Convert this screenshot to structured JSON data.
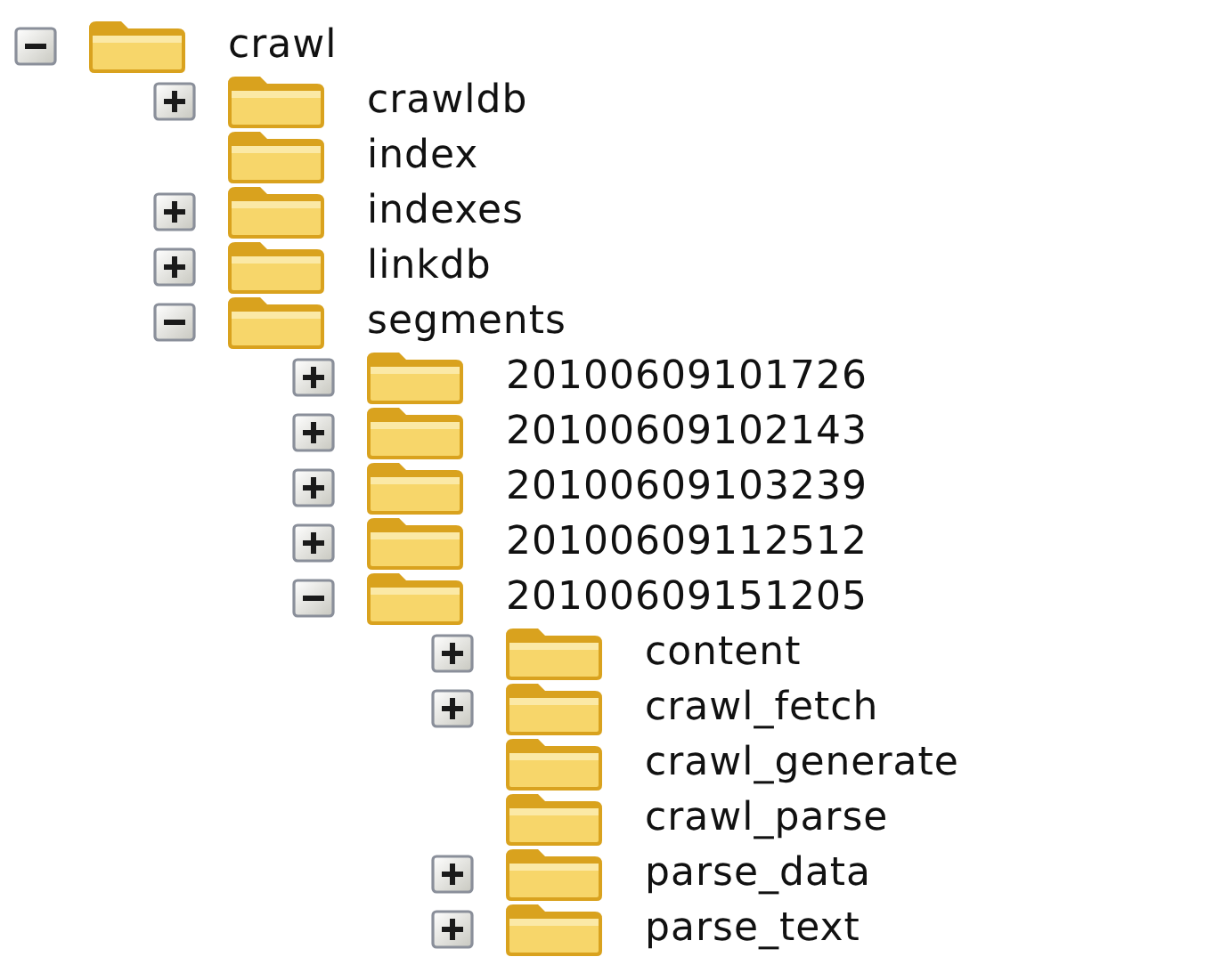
{
  "tree": [
    {
      "label": "crawl",
      "kind": "branch",
      "expanded": true,
      "children": [
        {
          "label": "crawldb",
          "kind": "branch",
          "expanded": false
        },
        {
          "label": "index",
          "kind": "leaf"
        },
        {
          "label": "indexes",
          "kind": "branch",
          "expanded": false
        },
        {
          "label": "linkdb",
          "kind": "branch",
          "expanded": false
        },
        {
          "label": "segments",
          "kind": "branch",
          "expanded": true,
          "children": [
            {
              "label": "20100609101726",
              "kind": "branch",
              "expanded": false
            },
            {
              "label": "20100609102143",
              "kind": "branch",
              "expanded": false
            },
            {
              "label": "20100609103239",
              "kind": "branch",
              "expanded": false
            },
            {
              "label": "20100609112512",
              "kind": "branch",
              "expanded": false
            },
            {
              "label": "20100609151205",
              "kind": "branch",
              "expanded": true,
              "children": [
                {
                  "label": "content",
                  "kind": "branch",
                  "expanded": false
                },
                {
                  "label": "crawl_fetch",
                  "kind": "branch",
                  "expanded": false
                },
                {
                  "label": "crawl_generate",
                  "kind": "leaf"
                },
                {
                  "label": "crawl_parse",
                  "kind": "leaf"
                },
                {
                  "label": "parse_data",
                  "kind": "branch",
                  "expanded": false
                },
                {
                  "label": "parse_text",
                  "kind": "branch",
                  "expanded": false
                }
              ]
            }
          ]
        }
      ]
    }
  ]
}
